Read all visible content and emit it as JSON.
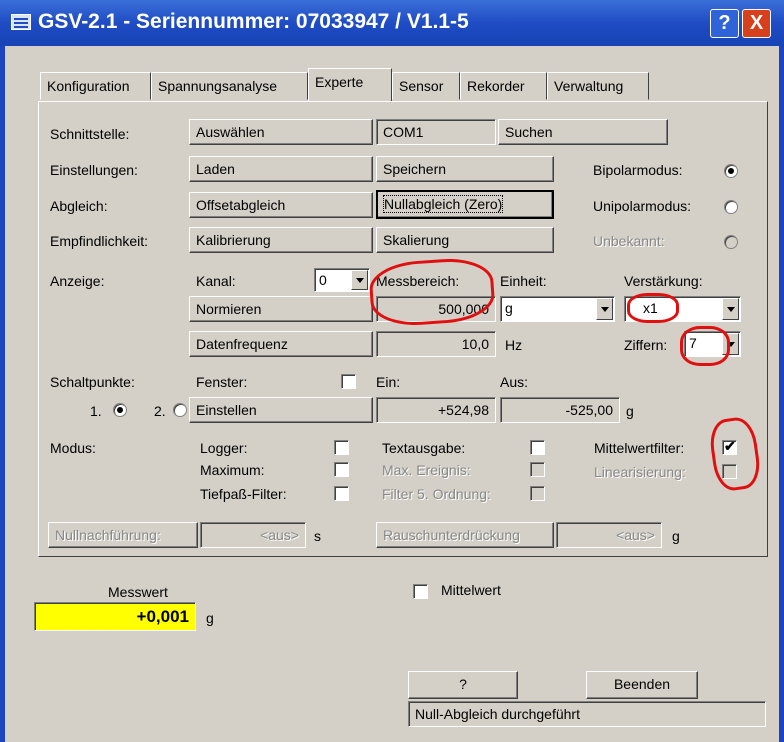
{
  "window": {
    "title": "GSV-2.1 - Seriennummer: 07033947 / V1.1-5",
    "help_glyph": "?",
    "close_glyph": "X"
  },
  "tabs": [
    "Konfiguration",
    "Spannungsanalyse",
    "Experte",
    "Sensor",
    "Rekorder",
    "Verwaltung"
  ],
  "active_tab": "Experte",
  "labels": {
    "schnittstelle": "Schnittstelle:",
    "einstellungen": "Einstellungen:",
    "abgleich": "Abgleich:",
    "empfindlichkeit": "Empfindlichkeit:",
    "anzeige": "Anzeige:",
    "kanal": "Kanal:",
    "messbereich": "Messbereich:",
    "einheit": "Einheit:",
    "verstaerkung": "Verstärkung:",
    "hz": "Hz",
    "ziffern": "Ziffern:",
    "schaltpunkte": "Schaltpunkte:",
    "fenster": "Fenster:",
    "ein": "Ein:",
    "aus": "Aus:",
    "g_unit": "g",
    "sp1": "1.",
    "sp2": "2.",
    "modus": "Modus:",
    "logger": "Logger:",
    "maximum": "Maximum:",
    "tiefpass": "Tiefpaß-Filter:",
    "textausgabe": "Textausgabe:",
    "max_ereignis": "Max. Ereignis:",
    "filter5": "Filter 5. Ordnung:",
    "mittelwertfilter": "Mittelwertfilter:",
    "linearisierung": "Linearisierung:",
    "s_unit": "s",
    "g_unit2": "g",
    "bipolar": "Bipolarmodus:",
    "unipolar": "Unipolarmodus:",
    "unbekannt": "Unbekannt:",
    "messwert": "Messwert",
    "mittelwert": "Mittelwert",
    "messwert_unit": "g"
  },
  "buttons": {
    "auswaehlen": "Auswählen",
    "suchen": "Suchen",
    "laden": "Laden",
    "speichern": "Speichern",
    "offsetabgleich": "Offsetabgleich",
    "nullabgleich": "Nullabgleich (Zero)",
    "kalibrierung": "Kalibrierung",
    "skalierung": "Skalierung",
    "normieren": "Normieren",
    "datenfrequenz": "Datenfrequenz",
    "einstellen": "Einstellen",
    "nullnachfuehrung": "Nullnachführung:",
    "rauschunterdrueckung": "Rauschunterdrückung",
    "help": "?",
    "beenden": "Beenden"
  },
  "values": {
    "com": "COM1",
    "kanal": "0",
    "messbereich": "500,000",
    "einheit": "g",
    "verstaerkung": "x1",
    "datenfrequenz": "10,0",
    "ziffern": "7",
    "ein": "+524,98",
    "aus": "-525,00",
    "nullnachfuehrung": "<aus>",
    "rauschunterdrueckung": "<aus>",
    "messwert": "+0,001",
    "status": "Null-Abgleich durchgeführt"
  },
  "state": {
    "bipolar": true,
    "unipolar": false,
    "unbekannt": false,
    "schaltpunkt": 1,
    "fenster": false,
    "logger": false,
    "maximum": false,
    "tiefpass": false,
    "textausgabe": false,
    "max_ereignis": false,
    "filter5": false,
    "mittelwertfilter": true,
    "linearisierung": false,
    "mittelwert": false
  },
  "colors": {
    "title_bar": "#1f4cc4",
    "highlight": "#ffff00",
    "annotation": "#e01010"
  }
}
